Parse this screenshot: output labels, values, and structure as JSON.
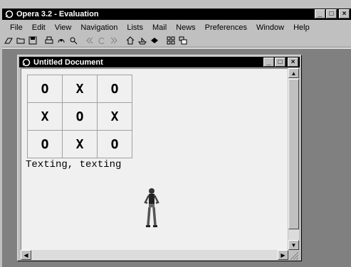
{
  "app": {
    "title": "Opera 3.2 - Evaluation",
    "menu": [
      "File",
      "Edit",
      "View",
      "Navigation",
      "Lists",
      "Mail",
      "News",
      "Preferences",
      "Window",
      "Help"
    ],
    "toolbar_icons": [
      "open-icon",
      "folder-icon",
      "save-icon",
      "print-icon",
      "hotlist-icon",
      "find-icon",
      "back-icon",
      "reload-icon",
      "forward-icon",
      "home-icon",
      "ship-icon",
      "eye-icon",
      "tile-icon",
      "cascade-icon"
    ]
  },
  "document_window": {
    "title": "Untitled Document",
    "board": [
      [
        "O",
        "X",
        "O"
      ],
      [
        "X",
        "O",
        "X"
      ],
      [
        "O",
        "X",
        "O"
      ]
    ],
    "text": "Texting, texting"
  },
  "colors": {
    "titlebar": "#000000",
    "chrome": "#c0c0c0",
    "mdi_background": "#808080",
    "page_background": "#f0f0f0"
  }
}
